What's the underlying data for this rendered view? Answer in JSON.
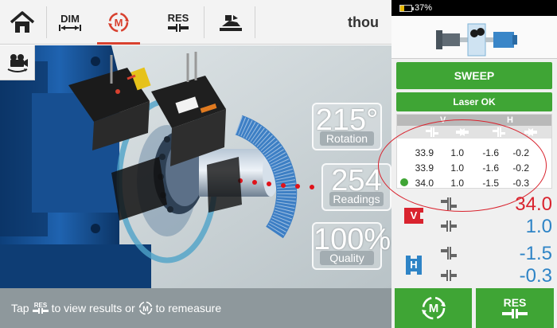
{
  "toolbar": {
    "home_label": "",
    "dim_label": "DIM",
    "measure_label": "M",
    "res_label": "RES",
    "units": "thou"
  },
  "scene": {
    "rotation": {
      "value": "215°",
      "label": "Rotation"
    },
    "readings": {
      "value": "254",
      "label": "Readings"
    },
    "quality": {
      "value": "100%",
      "label": "Quality"
    }
  },
  "status": {
    "text_prefix": "Tap",
    "res_icon_text": "RES",
    "text_middle": "to view results or",
    "m_icon_text": "M",
    "text_suffix": "to remeasure"
  },
  "system": {
    "battery": "37%",
    "battery_fraction": 0.37
  },
  "panel": {
    "sweep_label": "SWEEP",
    "laser_status": "Laser OK",
    "table": {
      "col_v": "V",
      "col_h": "H",
      "rows": [
        {
          "v_offset": "33.9",
          "v_gap": "1.0",
          "h_offset": "-1.6",
          "h_gap": "-0.2",
          "checked": false
        },
        {
          "v_offset": "33.9",
          "v_gap": "1.0",
          "h_offset": "-1.6",
          "h_gap": "-0.2",
          "checked": false
        },
        {
          "v_offset": "34.0",
          "v_gap": "1.0",
          "h_offset": "-1.5",
          "h_gap": "-0.3",
          "checked": true
        }
      ]
    },
    "vertical": {
      "badge": "V",
      "offset": "34.0",
      "gap": "1.0"
    },
    "horizontal": {
      "badge": "H",
      "offset": "-1.5",
      "gap": "-0.3"
    },
    "remeasure_label": "M",
    "results_label": "RES"
  },
  "colors": {
    "accent_green": "#3fa535",
    "measure_red": "#d8412f",
    "value_red": "#d9232e",
    "value_blue": "#2e84c6",
    "status_bar": "#8e989c"
  }
}
